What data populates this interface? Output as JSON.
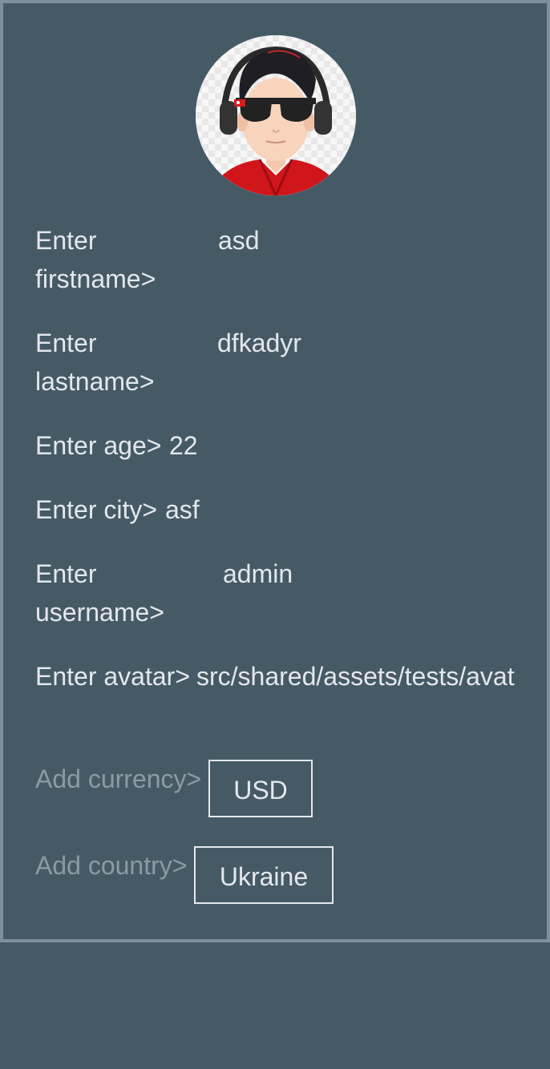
{
  "profile": {
    "avatar_alt": "avatar",
    "fields": [
      {
        "label": "Enter firstname>",
        "value": "asd"
      },
      {
        "label": "Enter lastname>",
        "value": "dfkadyr"
      },
      {
        "label": "Enter age>",
        "value": "22"
      },
      {
        "label": "Enter city>",
        "value": "asf"
      },
      {
        "label": "Enter username>",
        "value": "admin"
      },
      {
        "label": "Enter avatar>",
        "value": "src/shared/assets/tests/avat"
      }
    ],
    "currency": {
      "label": "Add currency>",
      "value": "USD"
    },
    "country": {
      "label": "Add country>",
      "value": "Ukraine"
    }
  },
  "colors": {
    "background": "#465a66",
    "border": "#7e909c",
    "text": "#e3e8ec",
    "muted": "#8b9ba6"
  }
}
